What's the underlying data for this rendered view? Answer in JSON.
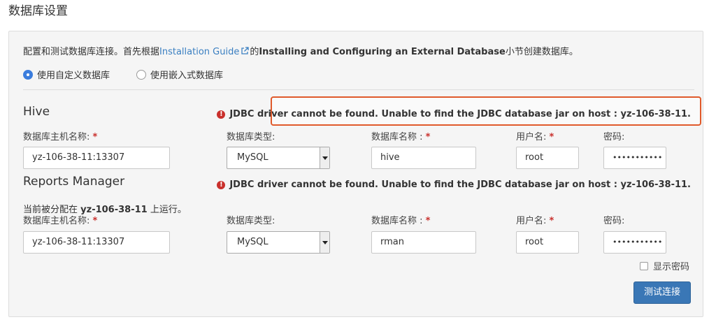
{
  "page_title": "数据库设置",
  "intro": {
    "prefix": "配置和测试数据库连接。首先根据",
    "link": "Installation Guide",
    "middle": "的",
    "bold": "Installing and Configuring an External Database",
    "suffix": "小节创建数据库。"
  },
  "radios": [
    {
      "label": "使用自定义数据库",
      "checked": true
    },
    {
      "label": "使用嵌入式数据库",
      "checked": false
    }
  ],
  "labels": {
    "host": "数据库主机名称:",
    "type": "数据库类型:",
    "dbname": "数据库名称 :",
    "user": "用户名:",
    "password": "密码:",
    "required_mark": "*"
  },
  "sections": [
    {
      "title": "Hive",
      "error": "JDBC driver cannot be found. Unable to find the JDBC database jar on host : yz-106-38-11.",
      "host": "yz-106-38-11:13307",
      "db_type": "MySQL",
      "db_name": "hive",
      "user": "root",
      "password": "•••••••••••"
    },
    {
      "title": "Reports Manager",
      "error": "JDBC driver cannot be found. Unable to find the JDBC database jar on host : yz-106-38-11.",
      "hint_prefix": "当前被分配在",
      "hint_host": "yz-106-38-11",
      "hint_suffix": "上运行。",
      "host": "yz-106-38-11:13307",
      "db_type": "MySQL",
      "db_name": "rman",
      "user": "root",
      "password": "•••••••••••"
    }
  ],
  "show_password_label": "显示密码",
  "test_button": "测试连接",
  "colors": {
    "link": "#3a7fc1",
    "error_icon": "#c9302c",
    "highlight_border": "#e05a2b",
    "button": "#3a77b6"
  }
}
